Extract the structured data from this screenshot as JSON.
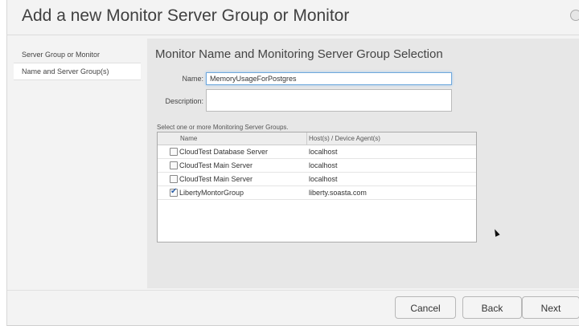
{
  "dialog": {
    "title": "Add a new Monitor Server Group or Monitor"
  },
  "sidebar": {
    "items": [
      {
        "label": "Server Group or Monitor"
      },
      {
        "label": "Name and Server Group(s)"
      }
    ]
  },
  "main": {
    "section_title": "Monitor Name and Monitoring Server Group Selection",
    "name_label": "Name:",
    "name_value": "MemoryUsageForPostgres",
    "description_label": "Description:",
    "description_value": "",
    "instructions": "Select one or more Monitoring Server Groups.",
    "table": {
      "headers": [
        "Name",
        "Host(s) / Device Agent(s)"
      ],
      "rows": [
        {
          "name": "CloudTest Database Server",
          "host": "localhost",
          "checked": false
        },
        {
          "name": "CloudTest Main Server",
          "host": "localhost",
          "checked": false
        },
        {
          "name": "CloudTest Main Server",
          "host": "localhost",
          "checked": false
        },
        {
          "name": "LibertyMontorGroup",
          "host": "liberty.soasta.com",
          "checked": true
        }
      ]
    }
  },
  "footer": {
    "cancel_label": "Cancel",
    "back_label": "Back",
    "next_label": "Next"
  },
  "colors": {
    "focus_border": "#6fa8dc",
    "check_mark": "#2a5fa8"
  }
}
